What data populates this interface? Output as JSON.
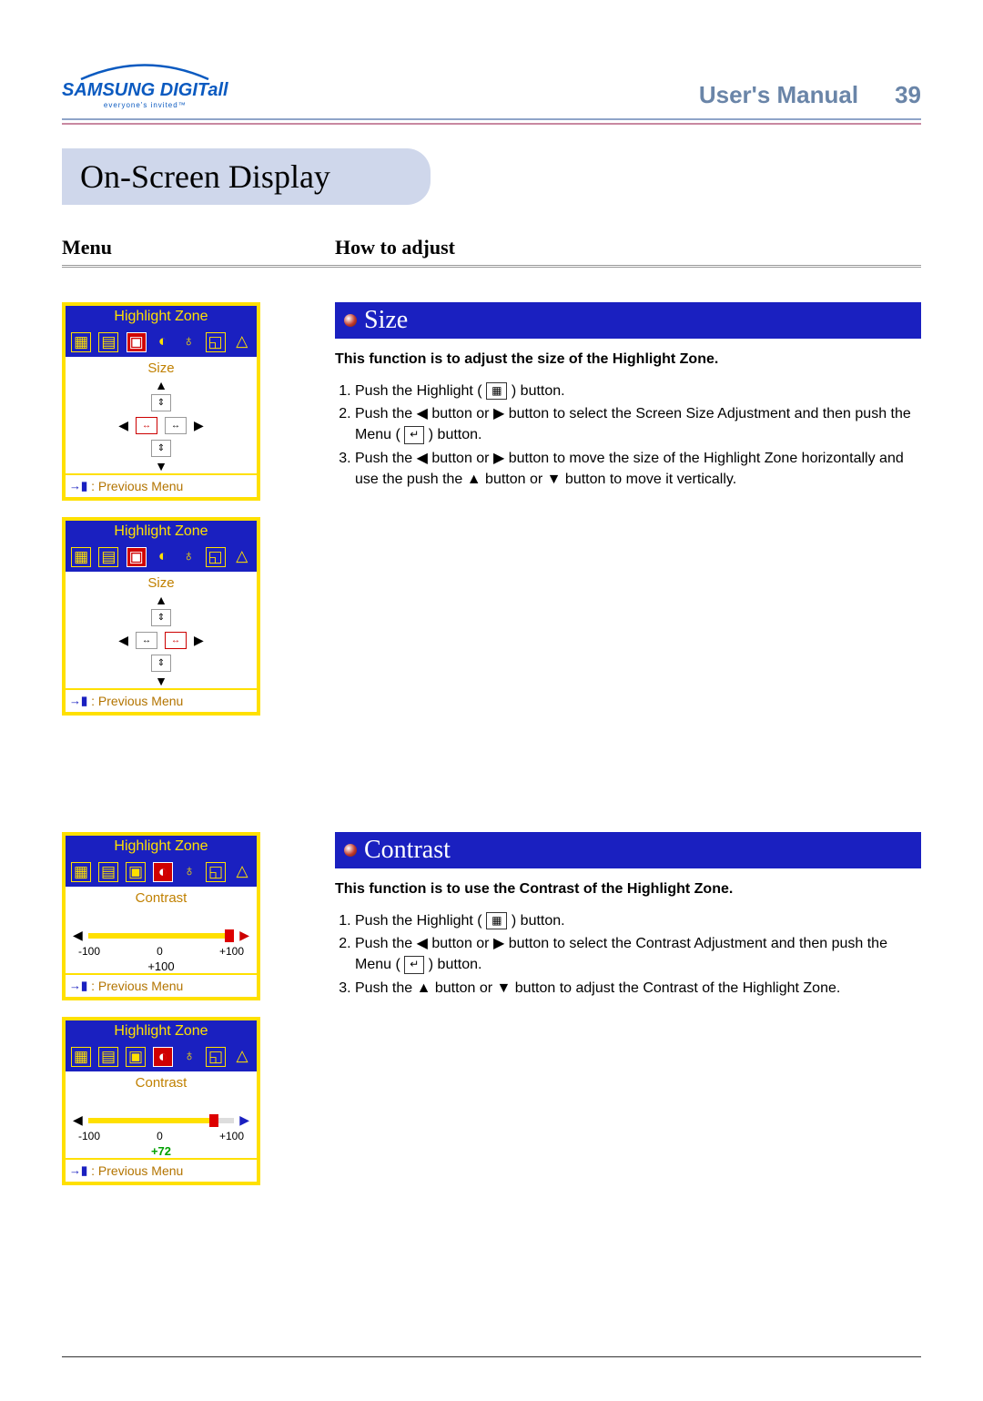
{
  "header": {
    "logo_main": "SAMSUNG DIGITall",
    "logo_sub": "everyone's invited™",
    "manual": "User's Manual",
    "page": "39"
  },
  "section_title": "On-Screen Display",
  "columns": {
    "menu": "Menu",
    "how": "How to adjust"
  },
  "osd": {
    "title": "Highlight Zone",
    "prev_menu": ": Previous Menu",
    "size_label": "Size",
    "contrast_label": "Contrast",
    "scale": {
      "min": "-100",
      "mid": "0",
      "max": "+100"
    },
    "contrast1_value": "+100",
    "contrast2_value": "+72"
  },
  "size": {
    "heading": "Size",
    "intro": "This function is to adjust the size of the Highlight Zone.",
    "steps": {
      "s1a": "Push the Highlight (",
      "s1b": ") button.",
      "s2a": "Push the ◀ button or ▶ button to select the Screen Size Adjustment and then push the Menu (",
      "s2b": ") button.",
      "s3": "Push the ◀ button or ▶ button to move the size of the Highlight Zone horizontally and use the push the ▲ button or ▼ button to move it vertically."
    }
  },
  "contrast": {
    "heading": "Contrast",
    "intro": "This function is to use the Contrast of the Highlight Zone.",
    "steps": {
      "s1a": "Push the Highlight (",
      "s1b": ") button.",
      "s2a": "Push the ◀ button or ▶ button to select the Contrast Adjustment and then push the Menu (",
      "s2b": ") button.",
      "s3": "Push the ▲ button or ▼ button to adjust the Contrast of the Highlight Zone."
    }
  }
}
